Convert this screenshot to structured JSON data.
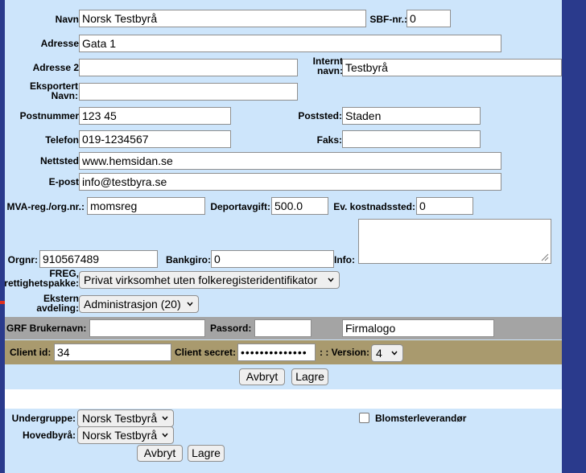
{
  "colors": {
    "panel_background": "#cde5fb",
    "gray_band": "#a4a4a4",
    "tan_band": "#a99a6e",
    "arrow": "#e0301e"
  },
  "icons": [
    "arrow-right-icon",
    "chevron-down-icon",
    "resize-grip-icon",
    "checkbox-icon"
  ],
  "form": {
    "navn": {
      "label": "Navn:",
      "value": "Norsk Testbyrå"
    },
    "sbf_nr": {
      "label": "SBF-nr.:",
      "value": "0"
    },
    "adresse": {
      "label": "Adresse:",
      "value": "Gata 1"
    },
    "adresse2": {
      "label": "Adresse 2:",
      "value": ""
    },
    "internt_navn": {
      "label": "Internt navn:",
      "value": "Testbyrå"
    },
    "eksportert_navn": {
      "label": "Eksportert Navn:",
      "value": ""
    },
    "postnummer": {
      "label": "Postnummer:",
      "value": "123 45"
    },
    "poststed": {
      "label": "Poststed:",
      "value": "Staden"
    },
    "telefon": {
      "label": "Telefon:",
      "value": "019-1234567"
    },
    "faks": {
      "label": "Faks:",
      "value": ""
    },
    "nettsted": {
      "label": "Nettsted:",
      "value": "www.hemsidan.se"
    },
    "epost": {
      "label": "E-post:",
      "value": "info@testbyra.se"
    },
    "mva": {
      "label": "MVA-reg./org.nr.:",
      "value": "momsreg"
    },
    "deportavgift": {
      "label": "Deportavgift:",
      "value": "500.0"
    },
    "kostnadssted": {
      "label": "Ev. kostnadssted:",
      "value": "0"
    },
    "orgnr": {
      "label": "Orgnr:",
      "value": "910567489"
    },
    "bankgiro": {
      "label": "Bankgiro:",
      "value": "0"
    },
    "info": {
      "label": "Info:",
      "value": ""
    },
    "freg": {
      "label": "FREG, rettighetspakke:",
      "selected": "Privat virksomhet uten folkeregisteridentifikator"
    },
    "ekstern_avdeling": {
      "label": "Ekstern avdeling:",
      "selected": "Administrasjon (20)"
    }
  },
  "grf": {
    "brukernavn_label": "GRF Brukernavn:",
    "brukernavn_value": "",
    "passord_label": "Passord:",
    "passord_value": "",
    "firmalogo_value": "Firmalogo"
  },
  "client": {
    "id_label": "Client id:",
    "id_value": "34",
    "secret_label": "Client secret:",
    "secret_value": "••••••••••••••",
    "version_label": ": : Version:",
    "version_selected": "4"
  },
  "buttons1": {
    "cancel": "Avbryt",
    "save": "Lagre"
  },
  "lower": {
    "undergruppe_label": "Undergruppe:",
    "undergruppe_selected": "Norsk Testbyrå",
    "hovedbyra_label": "Hovedbyrå:",
    "hovedbyra_selected": "Norsk Testbyrå",
    "blomster_label": "Blomsterleverandør",
    "blomster_checked": false
  },
  "buttons2": {
    "cancel": "Avbryt",
    "save": "Lagre"
  }
}
